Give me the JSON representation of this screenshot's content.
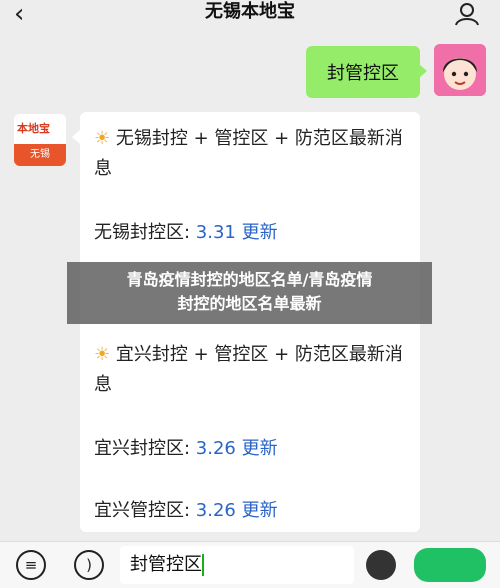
{
  "header": {
    "title": "无锡本地宝",
    "back_icon": "‹"
  },
  "my_message": {
    "text": "封管控区"
  },
  "bot": {
    "logo_text": "本地宝",
    "logo_sub": "无锡"
  },
  "card": {
    "heading1": "无锡封控 + 管控区 + 防范区最新消息",
    "wuxi_label": "无锡封控区: ",
    "wuxi_update": "3.31 更新",
    "heading2": "宜兴封控 + 管控区 + 防范区最新消息",
    "yixing_fk_label": "宜兴封控区: ",
    "yixing_fk_update": "3.26 更新",
    "yixing_gk_label": "宜兴管控区: ",
    "yixing_gk_update": "3.26 更新"
  },
  "overlay": {
    "line1": "青岛疫情封控的地区名单/青岛疫情",
    "line2": "封控的地区名单最新"
  },
  "input": {
    "value": "封管控区"
  },
  "icons": {
    "menu": "menu-icon",
    "voice": "voice-icon",
    "emoji": "emoji-icon"
  }
}
